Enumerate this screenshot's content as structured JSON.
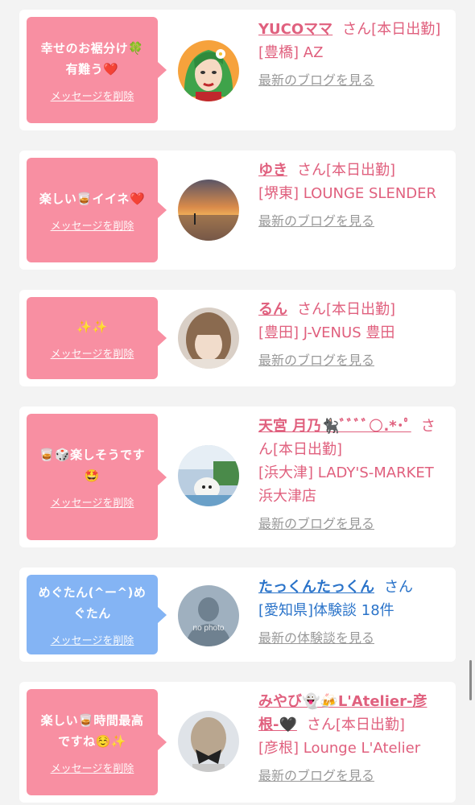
{
  "items": [
    {
      "message": "幸せのお裾分け🍀有難う❤️",
      "delete_label": "メッセージを削除",
      "name": "YUCOママ",
      "suffix": "さん[本日出勤]",
      "detail": "[豊橋] AZ",
      "link": "最新のブログを見る",
      "avatar": "illustrated-woman-avatar"
    },
    {
      "message": "楽しい🥃イイネ❤️",
      "delete_label": "メッセージを削除",
      "name": "ゆき",
      "suffix": "さん[本日出勤]",
      "detail": "[堺東] LOUNGE SLENDER",
      "link": "最新のブログを見る",
      "avatar": "sunset-beach-avatar"
    },
    {
      "message": "✨✨",
      "delete_label": "メッセージを削除",
      "name": "るん",
      "suffix": "さん[本日出勤]",
      "detail": "[豊田] J-VENUS 豊田",
      "link": "最新のブログを見る",
      "avatar": "woman-photo-avatar"
    },
    {
      "message": "🥃🎲楽しそうです🤩",
      "delete_label": "メッセージを削除",
      "name": "天宮 月乃🐈‍⬛ﾞﾞﾞﾞ🌕.*･ﾟ",
      "suffix": "さん[本日出勤]",
      "detail": "[浜大津] LADY'S-MARKET 浜大津店",
      "link": "最新のブログを見る",
      "avatar": "dog-photo-avatar"
    },
    {
      "message": "めぐたん(^ー^)めぐたん",
      "delete_label": "メッセージを削除",
      "name": "たっくんたっくん",
      "suffix": "さん",
      "detail": "[愛知県]体験談 18件",
      "link": "最新の体験談を見る",
      "avatar": "no-photo-avatar",
      "avatar_text": "no photo"
    },
    {
      "message": "楽しい🥃時間最高ですね☺️✨",
      "delete_label": "メッセージを削除",
      "name": "みやび👻🍻L'Atelier-彦根-🖤",
      "suffix": "さん[本日出勤]",
      "detail": "[彦根] Lounge L'Atelier",
      "link": "最新のブログを見る",
      "avatar": "hair-photo-avatar"
    }
  ],
  "colors": {
    "bubble_pink": "#f88fa2",
    "bubble_blue": "#84b4f4",
    "text_pink": "#e0607e",
    "text_blue": "#2a73c9",
    "link_gray": "#999999",
    "background": "#f3f3f3"
  }
}
